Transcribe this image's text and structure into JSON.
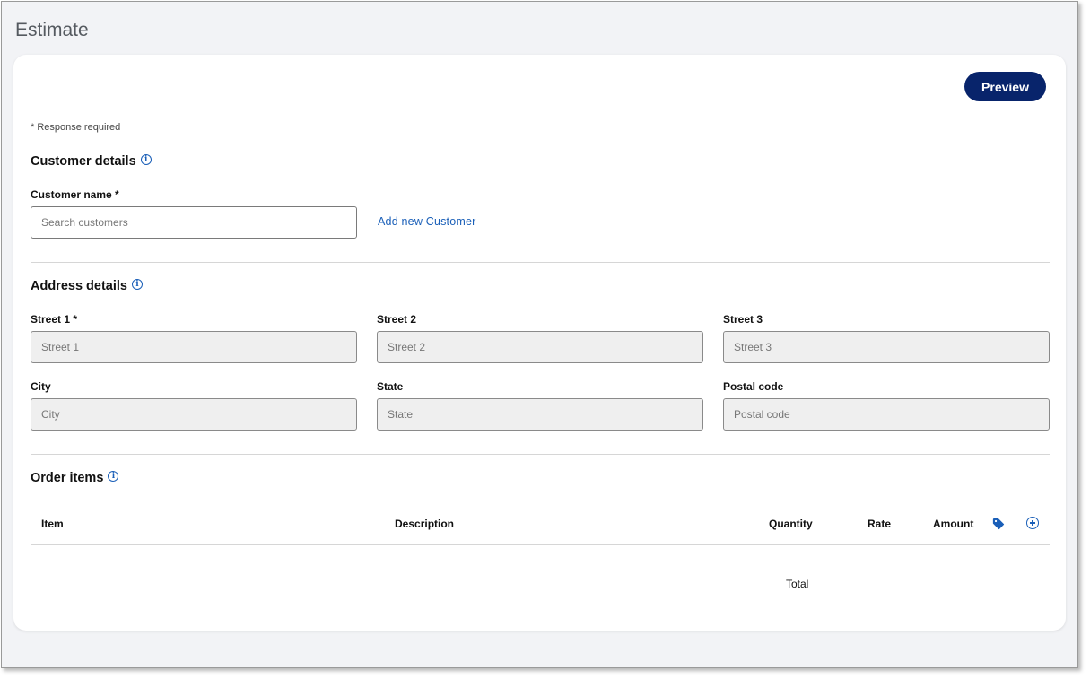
{
  "page": {
    "title": "Estimate"
  },
  "toolbar": {
    "preview_label": "Preview"
  },
  "form": {
    "required_note": "* Response required"
  },
  "customer": {
    "section_title": "Customer details",
    "name_label": "Customer name *",
    "search_placeholder": "Search customers",
    "add_link": "Add new Customer"
  },
  "address": {
    "section_title": "Address details",
    "street1": {
      "label": "Street 1 *",
      "placeholder": "Street 1"
    },
    "street2": {
      "label": "Street 2",
      "placeholder": "Street 2"
    },
    "street3": {
      "label": "Street 3",
      "placeholder": "Street 3"
    },
    "city": {
      "label": "City",
      "placeholder": "City"
    },
    "state": {
      "label": "State",
      "placeholder": "State"
    },
    "postal": {
      "label": "Postal code",
      "placeholder": "Postal code"
    }
  },
  "order": {
    "section_title": "Order items",
    "columns": {
      "item": "Item",
      "description": "Description",
      "quantity": "Quantity",
      "rate": "Rate",
      "amount": "Amount"
    },
    "total_label": "Total"
  },
  "icons": {
    "info": "info-circle-icon",
    "tag": "tag-icon",
    "add": "plus-circle-icon"
  },
  "colors": {
    "primary_button": "#08246b",
    "link": "#1a5fb8",
    "page_bg": "#f2f3f6",
    "disabled_input_bg": "#efefef"
  }
}
